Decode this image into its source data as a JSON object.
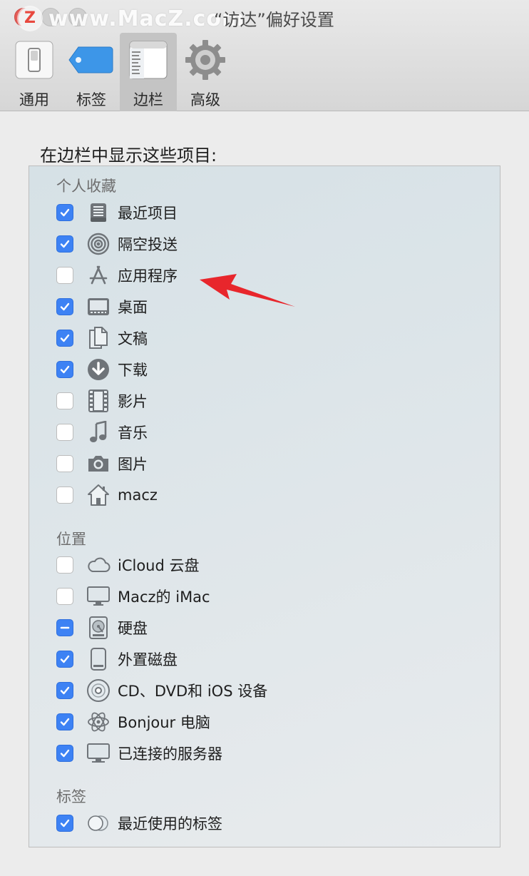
{
  "window": {
    "title": "“访达”偏好设置",
    "watermark_text": "www.MacZ.com",
    "watermark_badge": "Z"
  },
  "toolbar": {
    "tabs": [
      {
        "label": "通用",
        "icon": "general-switch-icon",
        "active": false
      },
      {
        "label": "标签",
        "icon": "tag-icon",
        "active": false
      },
      {
        "label": "边栏",
        "icon": "sidebar-icon",
        "active": true
      },
      {
        "label": "高级",
        "icon": "gear-icon",
        "active": false
      }
    ]
  },
  "content": {
    "heading": "在边栏中显示这些项目:",
    "sections": [
      {
        "title": "个人收藏",
        "items": [
          {
            "label": "最近项目",
            "icon": "recents-icon",
            "state": "checked"
          },
          {
            "label": "隔空投送",
            "icon": "airdrop-icon",
            "state": "checked"
          },
          {
            "label": "应用程序",
            "icon": "applications-icon",
            "state": "unchecked"
          },
          {
            "label": "桌面",
            "icon": "desktop-icon",
            "state": "checked"
          },
          {
            "label": "文稿",
            "icon": "documents-icon",
            "state": "checked"
          },
          {
            "label": "下载",
            "icon": "downloads-icon",
            "state": "checked"
          },
          {
            "label": "影片",
            "icon": "movies-icon",
            "state": "unchecked"
          },
          {
            "label": "音乐",
            "icon": "music-icon",
            "state": "unchecked"
          },
          {
            "label": "图片",
            "icon": "pictures-icon",
            "state": "unchecked"
          },
          {
            "label": "macz",
            "icon": "home-icon",
            "state": "unchecked"
          }
        ]
      },
      {
        "title": "位置",
        "items": [
          {
            "label": "iCloud 云盘",
            "icon": "icloud-icon",
            "state": "unchecked"
          },
          {
            "label": "Macz的 iMac",
            "icon": "imac-icon",
            "state": "unchecked"
          },
          {
            "label": "硬盘",
            "icon": "hard-disk-icon",
            "state": "mixed"
          },
          {
            "label": "外置磁盘",
            "icon": "external-disk-icon",
            "state": "checked"
          },
          {
            "label": "CD、DVD和 iOS 设备",
            "icon": "optical-disc-icon",
            "state": "checked"
          },
          {
            "label": "Bonjour 电脑",
            "icon": "bonjour-icon",
            "state": "checked"
          },
          {
            "label": "已连接的服务器",
            "icon": "server-icon",
            "state": "checked"
          }
        ]
      },
      {
        "title": "标签",
        "items": [
          {
            "label": "最近使用的标签",
            "icon": "recent-tags-icon",
            "state": "checked"
          }
        ]
      }
    ]
  },
  "colors": {
    "checkbox_on": "#3d82f4",
    "annotation_arrow": "#e8262c"
  }
}
